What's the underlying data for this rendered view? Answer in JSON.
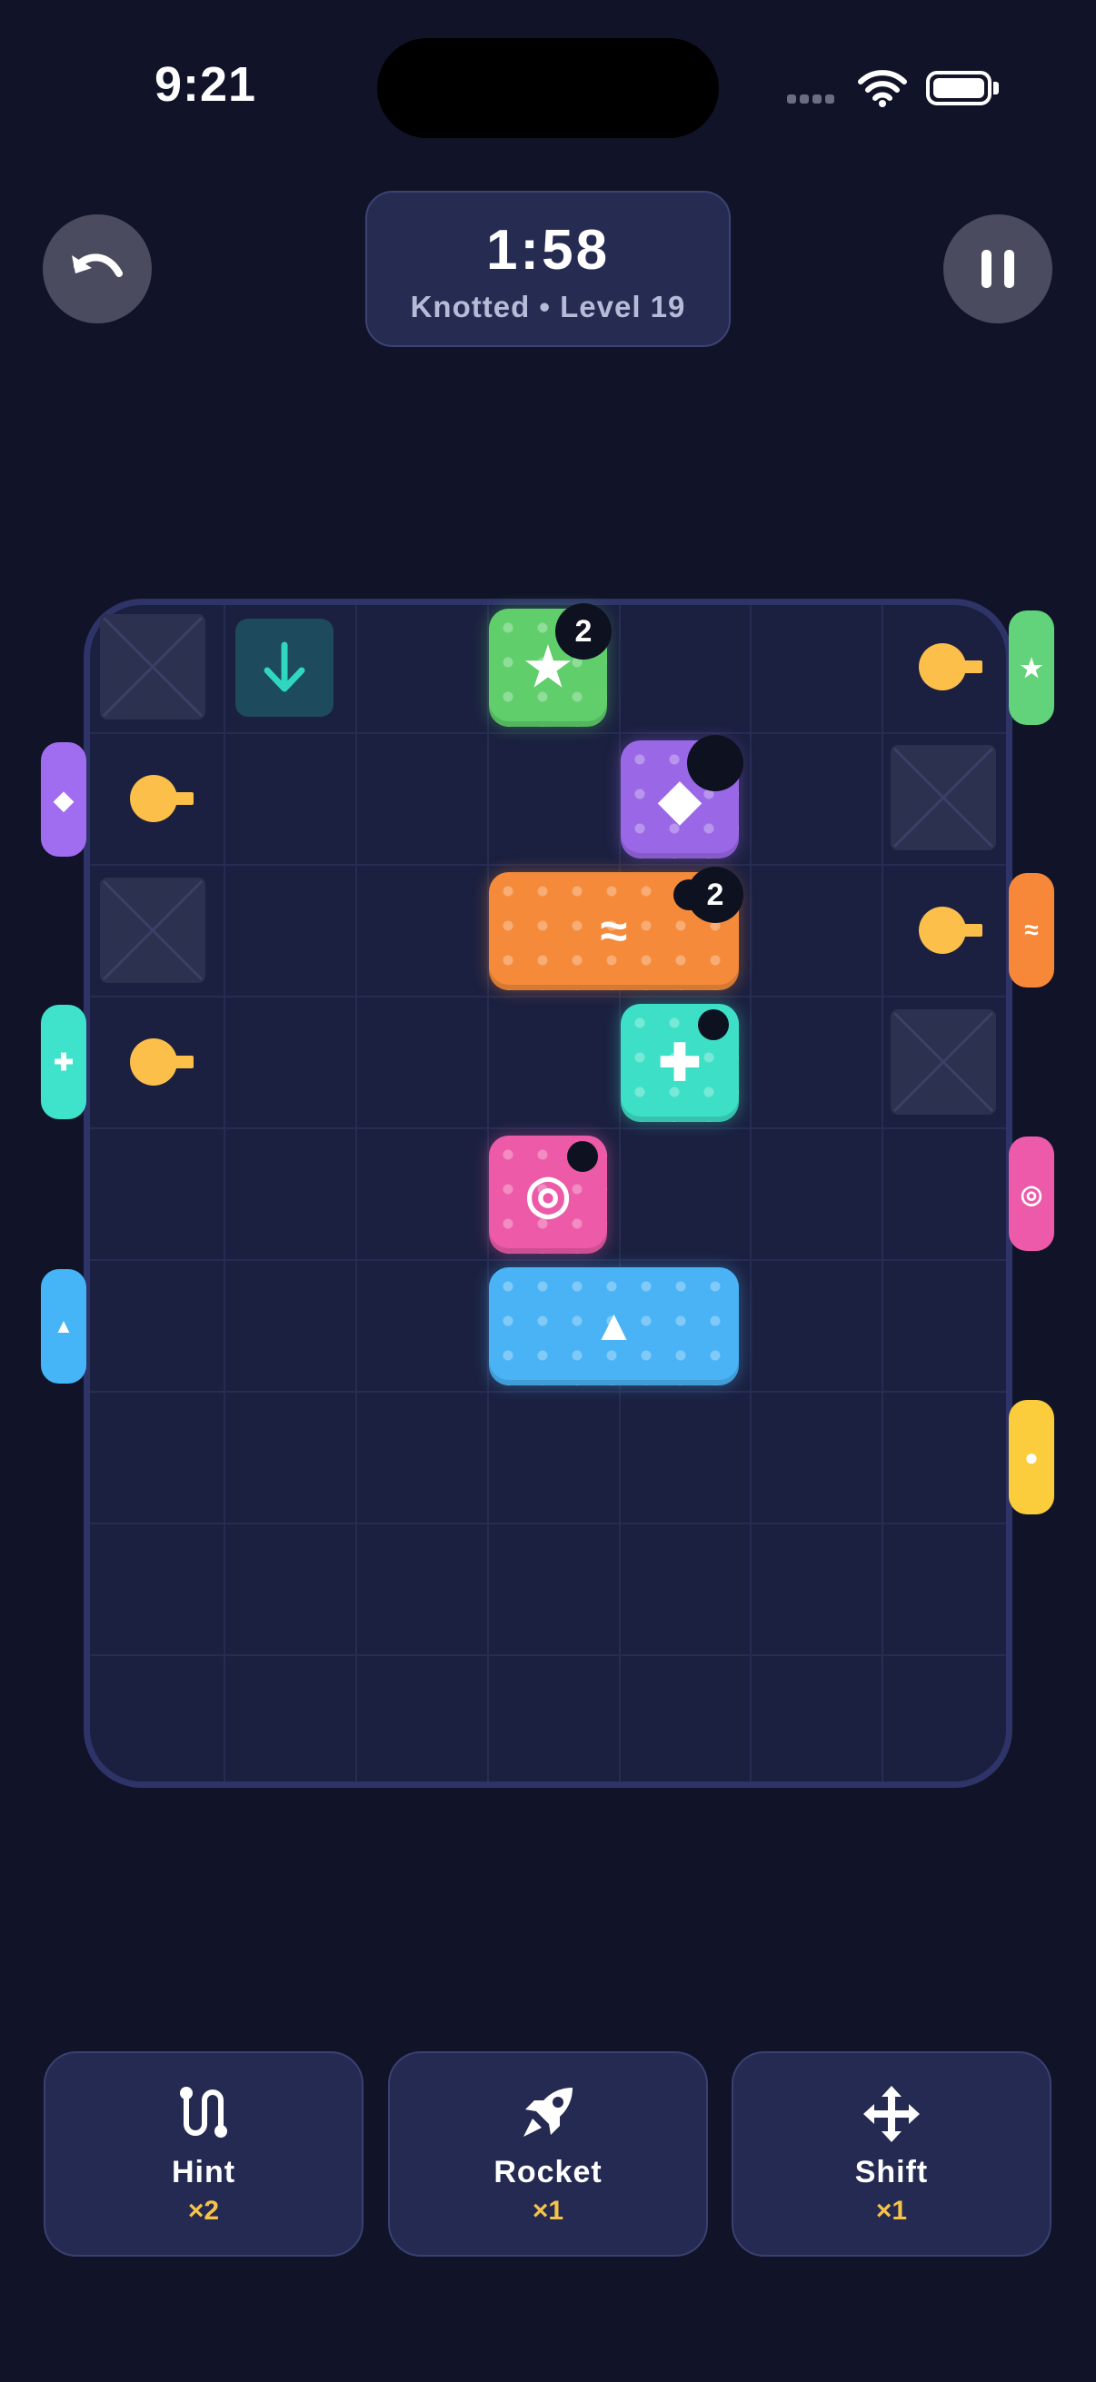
{
  "status_bar": {
    "time": "9:21"
  },
  "header": {
    "timer": "1:58",
    "subtitle": "Knotted • Level 19"
  },
  "board": {
    "blocks": [
      {
        "color": "#5fce6b",
        "symbol": "★",
        "badge": "2"
      },
      {
        "color": "#9a68e6",
        "symbol": "◆"
      },
      {
        "color": "#f48a3a",
        "symbol": "≈",
        "badge": "2"
      },
      {
        "color": "#3ddfc6",
        "symbol": "✚"
      },
      {
        "color": "#ec5aa8",
        "symbol": "◎"
      },
      {
        "color": "#4ab3f5",
        "symbol": "▲"
      }
    ],
    "left_tabs": [
      {
        "color": "#a16df0",
        "symbol": "◆"
      },
      {
        "color": "#3fe3cc",
        "symbol": "✚"
      },
      {
        "color": "#45b5f7",
        "symbol": "▲"
      }
    ],
    "right_tabs": [
      {
        "color": "#62d37a",
        "symbol": "★"
      },
      {
        "color": "#f7883a",
        "symbol": "≈"
      },
      {
        "color": "#ee5aaa",
        "symbol": "◎"
      },
      {
        "color": "#fbcd3c",
        "symbol": "●"
      }
    ]
  },
  "powerups": [
    {
      "label": "Hint",
      "count": "×2",
      "icon": "path-icon"
    },
    {
      "label": "Rocket",
      "count": "×1",
      "icon": "rocket-icon"
    },
    {
      "label": "Shift",
      "count": "×1",
      "icon": "move-arrows-icon"
    }
  ]
}
